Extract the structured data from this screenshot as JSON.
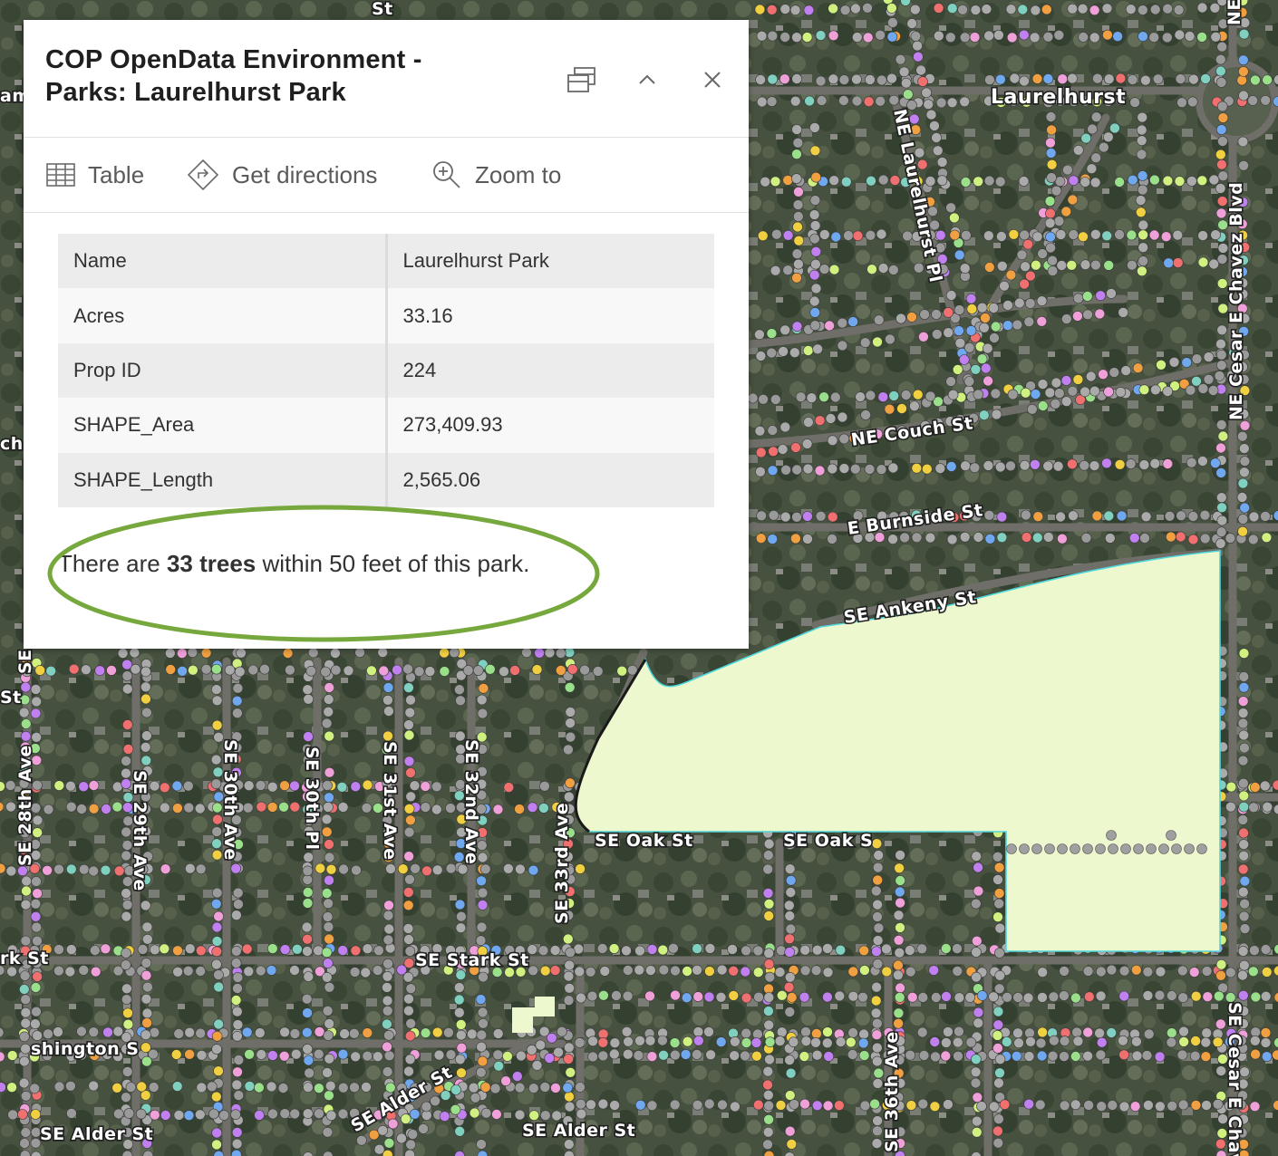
{
  "popup": {
    "title_line1": "COP OpenData Environment -",
    "title_line2": "Parks: Laurelhurst Park",
    "actions": [
      {
        "label": "Table",
        "icon": "table-icon"
      },
      {
        "label": "Get directions",
        "icon": "directions-icon"
      },
      {
        "label": "Zoom to",
        "icon": "zoom-to-icon"
      }
    ],
    "header_buttons": [
      "dock-icon",
      "collapse-chevron-up-icon",
      "close-icon"
    ],
    "attributes": [
      {
        "key": "Name",
        "value": "Laurelhurst Park"
      },
      {
        "key": "Acres",
        "value": "33.16"
      },
      {
        "key": "Prop ID",
        "value": "224"
      },
      {
        "key": "SHAPE_Area",
        "value": "273,409.93"
      },
      {
        "key": "SHAPE_Length",
        "value": "2,565.06"
      }
    ],
    "summary": {
      "prefix": "There are ",
      "bold": "33 trees",
      "suffix": " within 50 feet of this park."
    },
    "highlight_color": "#77a83e"
  },
  "map": {
    "park_fill": "#eef8cf",
    "park_outline": "#4fd8dc",
    "tree_colors": [
      "#9a9a9a",
      "#aaaaaa",
      "#f07070",
      "#f0a0d8",
      "#c080f0",
      "#9ae08a",
      "#d0f080",
      "#80d0c0",
      "#70a8f0",
      "#f0d040",
      "#f0a040"
    ],
    "labels": {
      "top_st": "St",
      "laurelhurst": "Laurelhurst",
      "ne_couch": "NE Couch St",
      "e_burnside": "E Burnside St",
      "se_ankeny": "SE Ankeny St",
      "se_oak_1": "SE Oak St",
      "se_oak_2": "SE Oak S",
      "se_stark": "SE Stark St",
      "se_stark_left": "rk St",
      "washington": "shington S",
      "se_alder": "SE Alder St",
      "se_alder_2": "SE Alder St",
      "se_alder_3": "SE Alder St",
      "se_30th_pl": "SE 30th Pl",
      "se_31st": "SE 31st Ave",
      "se_32nd": "SE 32nd Ave",
      "se_30th_ave": "SE 30th Ave",
      "se_29th": "SE 29th Ave",
      "se_28th": "SE 28th Ave",
      "se_36th": "SE 36th Ave",
      "se_33rd": "SE 33rd Ave",
      "cesar_chavez_top": "NE Cesar E Chavez Blvd",
      "cesar_chavez_bottom": "SE Cesar E Chav",
      "ne_laurelhurst_pl": "NE Laurelhurst Pl",
      "ne_top": "NE",
      "left_am": "am",
      "left_ch": "ch",
      "left_st": "St",
      "left_se": "SE"
    }
  }
}
